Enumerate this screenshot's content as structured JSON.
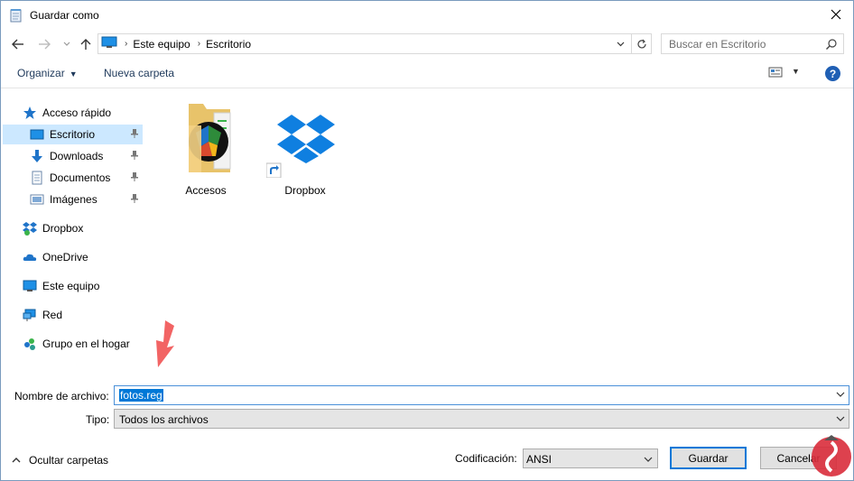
{
  "window": {
    "title": "Guardar como"
  },
  "address": {
    "crumbs": [
      "Este equipo",
      "Escritorio"
    ]
  },
  "search": {
    "placeholder": "Buscar en Escritorio"
  },
  "toolbar": {
    "organize_label": "Organizar",
    "new_folder_label": "Nueva carpeta",
    "help_label": "?"
  },
  "sidebar": {
    "items": [
      {
        "label": "Acceso rápido",
        "icon": "star-icon"
      },
      {
        "label": "Escritorio",
        "icon": "desktop-icon",
        "pinned": true,
        "selected": true
      },
      {
        "label": "Downloads",
        "icon": "download-arrow-icon",
        "pinned": true
      },
      {
        "label": "Documentos",
        "icon": "document-icon",
        "pinned": true
      },
      {
        "label": "Imágenes",
        "icon": "pictures-icon",
        "pinned": true
      },
      {
        "label": "Dropbox",
        "icon": "dropbox-icon"
      },
      {
        "label": "OneDrive",
        "icon": "cloud-icon"
      },
      {
        "label": "Este equipo",
        "icon": "computer-icon"
      },
      {
        "label": "Red",
        "icon": "network-icon"
      },
      {
        "label": "Grupo en el hogar",
        "icon": "homegroup-icon"
      }
    ]
  },
  "files": [
    {
      "name": "Accesos",
      "icon": "folder-icon"
    },
    {
      "name": "Dropbox",
      "icon": "dropbox-shortcut-icon"
    }
  ],
  "form": {
    "filename_label": "Nombre de archivo:",
    "filename_value": "fotos.reg",
    "type_label": "Tipo:",
    "type_value": "Todos los archivos",
    "encoding_label": "Codificación:",
    "encoding_value": "ANSI"
  },
  "footer": {
    "hide_folders_label": "Ocultar carpetas",
    "save_label": "Guardar",
    "cancel_label": "Cancelar"
  },
  "colors": {
    "selection": "#cce8ff",
    "accent": "#0078d7",
    "annotation_arrow": "#f26464"
  }
}
